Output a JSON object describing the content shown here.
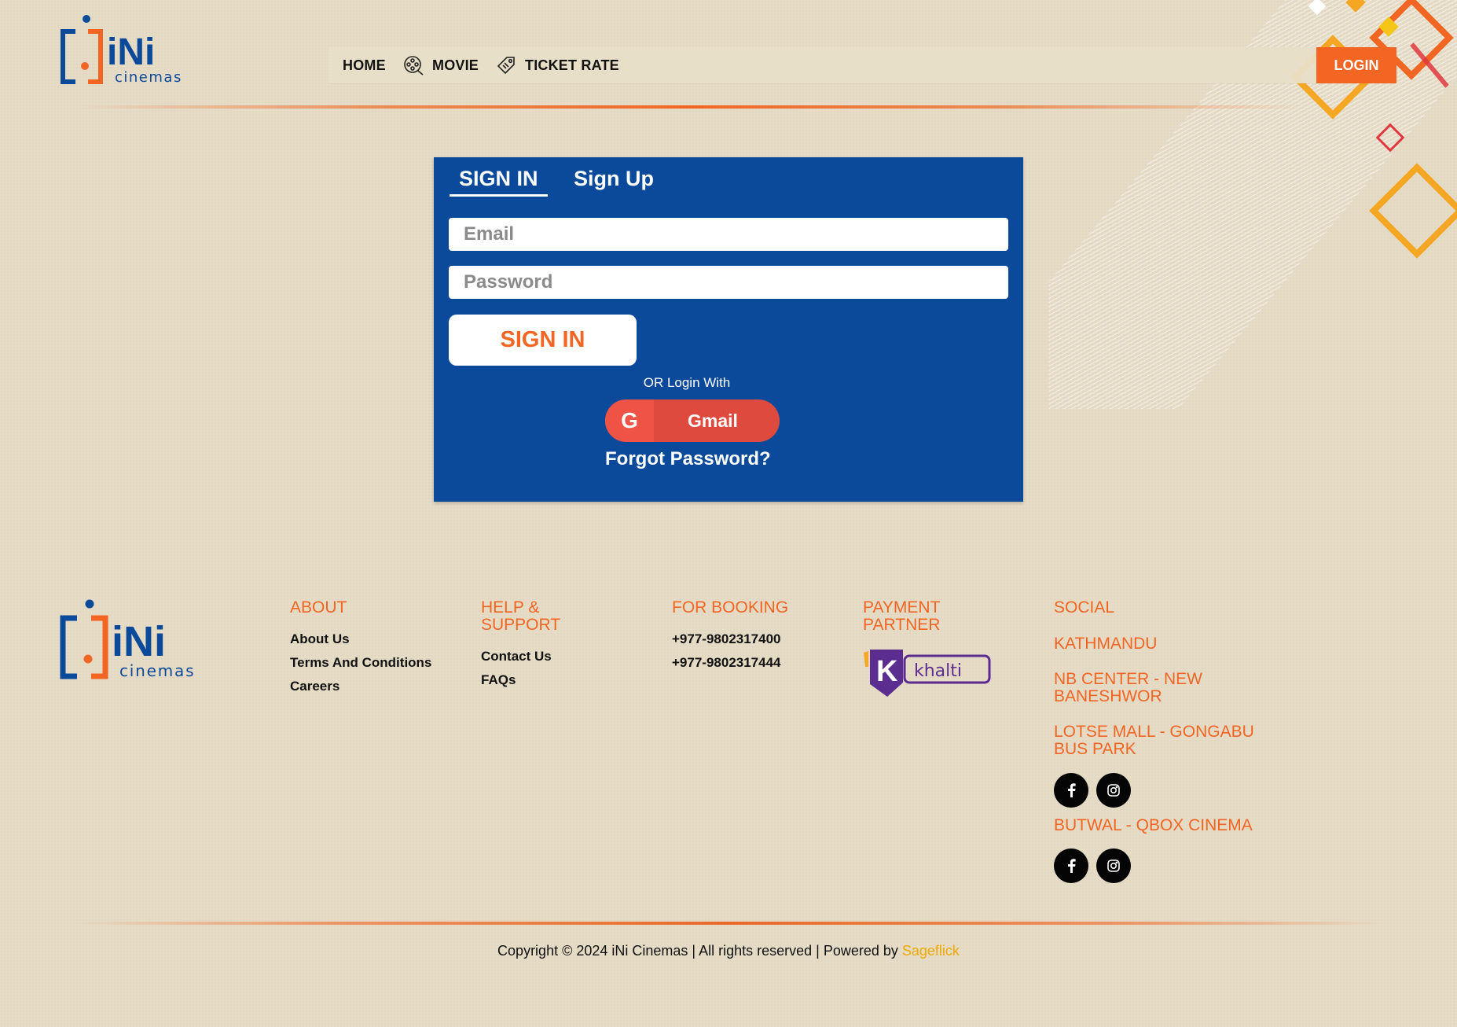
{
  "brand": {
    "logo_main": "iNi",
    "logo_sub": "cinemas"
  },
  "nav": {
    "items": [
      {
        "label": "HOME",
        "icon": ""
      },
      {
        "label": "MOVIE",
        "icon": "film-reel-icon"
      },
      {
        "label": "TICKET RATE",
        "icon": "ticket-tag-icon"
      }
    ],
    "login_label": "LOGIN"
  },
  "auth": {
    "tabs": {
      "signin": "SIGN IN",
      "signup": "Sign Up"
    },
    "email_placeholder": "Email",
    "password_placeholder": "Password",
    "signin_button": "SIGN IN",
    "or_text": "OR Login With",
    "gmail_icon_letter": "G",
    "gmail_label": "Gmail",
    "forgot_label": "Forgot Password?"
  },
  "footer": {
    "about": {
      "heading": "ABOUT",
      "links": [
        "About Us",
        "Terms And Conditions",
        "Careers"
      ]
    },
    "help": {
      "heading": "HELP & SUPPORT",
      "links": [
        "Contact Us",
        "FAQs"
      ]
    },
    "booking": {
      "heading": "FOR BOOKING",
      "phones": [
        "+977-9802317400",
        "+977-9802317444"
      ]
    },
    "payment": {
      "heading": "PAYMENT PARTNER",
      "partner": "khalti",
      "partner_letter": "K"
    },
    "social": {
      "heading": "SOCIAL",
      "locations": [
        "KATHMANDU",
        "NB CENTER  - NEW BANESHWOR",
        "LOTSE MALL  - GONGABU BUS PARK",
        "BUTWAL - QBOX CINEMA"
      ]
    }
  },
  "copyright": {
    "text": "Copyright © 2024 iNi Cinemas | All rights reserved | Powered by ",
    "powered_by": "Sageflick"
  },
  "colors": {
    "accent": "#f26522",
    "card": "#0b4a9b",
    "gmail": "#df4a3f",
    "logo_blue": "#0b4a9b"
  }
}
